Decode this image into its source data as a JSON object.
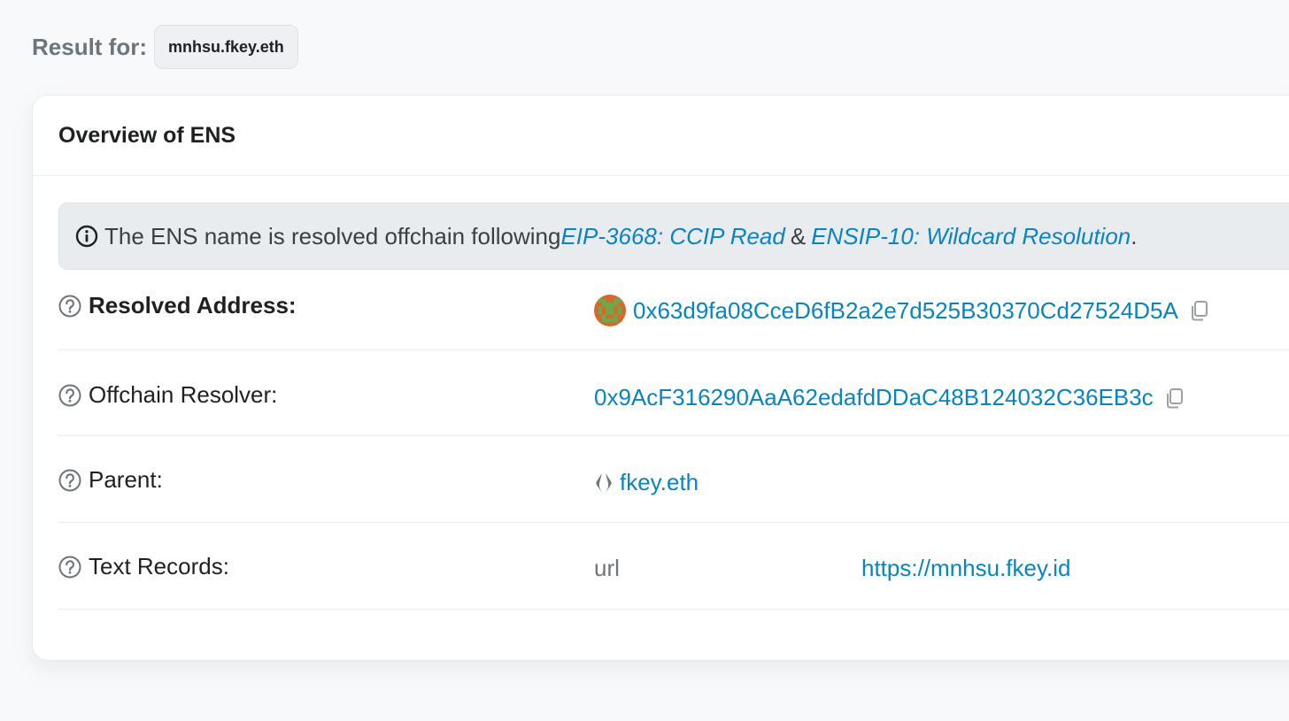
{
  "result": {
    "label": "Result for:",
    "query": "mnhsu.fkey.eth"
  },
  "overview": {
    "title": "Overview of ENS",
    "notice": {
      "prefix": "The ENS name is resolved offchain following ",
      "link1": "EIP-3668: CCIP Read",
      "amp": "&",
      "link2": "ENSIP-10: Wildcard Resolution",
      "suffix": "."
    },
    "rows": {
      "resolved_address": {
        "label": "Resolved Address:",
        "value": "0x63d9fa08CceD6fB2a2e7d525B30370Cd27524D5A"
      },
      "offchain_resolver": {
        "label": "Offchain Resolver:",
        "value": "0x9AcF316290AaA62edafdDDaC48B124032C36EB3c"
      },
      "parent": {
        "label": "Parent:",
        "value": "fkey.eth"
      },
      "text_records": {
        "label": "Text Records:",
        "key": "url",
        "value": "https://mnhsu.fkey.id"
      }
    }
  },
  "colors": {
    "link": "#0784c3",
    "muted": "#6c757d",
    "avatar_orange": "#d9662a",
    "avatar_green": "#6ca94a"
  },
  "icons": [
    "info-icon",
    "question-icon",
    "copy-icon",
    "ens-logo-icon",
    "identicon"
  ]
}
